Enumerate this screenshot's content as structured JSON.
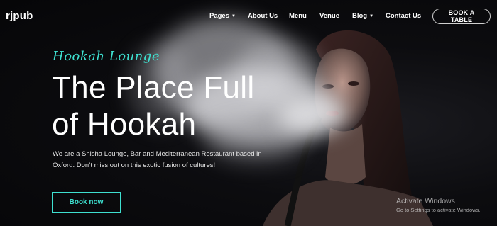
{
  "brand": {
    "logo": "rjpub"
  },
  "nav": {
    "items": [
      {
        "label": "Pages",
        "has_dropdown": true
      },
      {
        "label": "About Us",
        "has_dropdown": false
      },
      {
        "label": "Menu",
        "has_dropdown": false
      },
      {
        "label": "Venue",
        "has_dropdown": false
      },
      {
        "label": "Blog",
        "has_dropdown": true
      },
      {
        "label": "Contact Us",
        "has_dropdown": false
      }
    ],
    "cta": "BOOK A TABLE"
  },
  "hero": {
    "script_title": "Hookah Lounge",
    "headline_line1": "The Place Full",
    "headline_line2": "of Hookah",
    "description": "We are a Shisha Lounge, Bar and Mediterranean Restaurant based in Oxford. Don’t miss out on this exotic fusion of cultures!",
    "button": "Book now"
  },
  "watermark": {
    "title": "Activate Windows",
    "subtitle": "Go to Settings to activate Windows."
  },
  "colors": {
    "accent": "#3ee0d0",
    "background": "#0a0a0c"
  },
  "icons": {
    "dropdown": "chevron-down-icon"
  }
}
